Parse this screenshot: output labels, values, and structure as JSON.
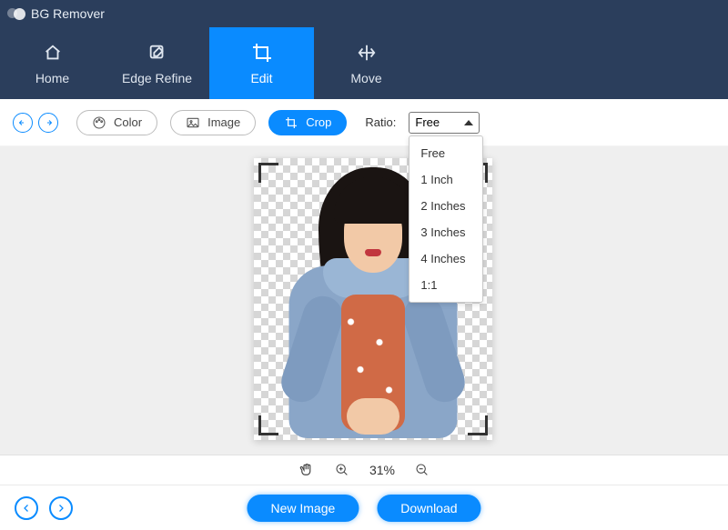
{
  "app": {
    "title": "BG Remover"
  },
  "nav": {
    "items": [
      {
        "label": "Home"
      },
      {
        "label": "Edge Refine"
      },
      {
        "label": "Edit"
      },
      {
        "label": "Move"
      }
    ]
  },
  "toolbar": {
    "color_label": "Color",
    "image_label": "Image",
    "crop_label": "Crop",
    "ratio_label": "Ratio:",
    "ratio_value": "Free",
    "ratio_options": [
      "Free",
      "1 Inch",
      "2 Inches",
      "3 Inches",
      "4 Inches",
      "1:1"
    ]
  },
  "status": {
    "zoom": "31%"
  },
  "footer": {
    "new_image_label": "New Image",
    "download_label": "Download"
  },
  "colors": {
    "accent": "#0a8bff",
    "header": "#2b3e5c"
  }
}
